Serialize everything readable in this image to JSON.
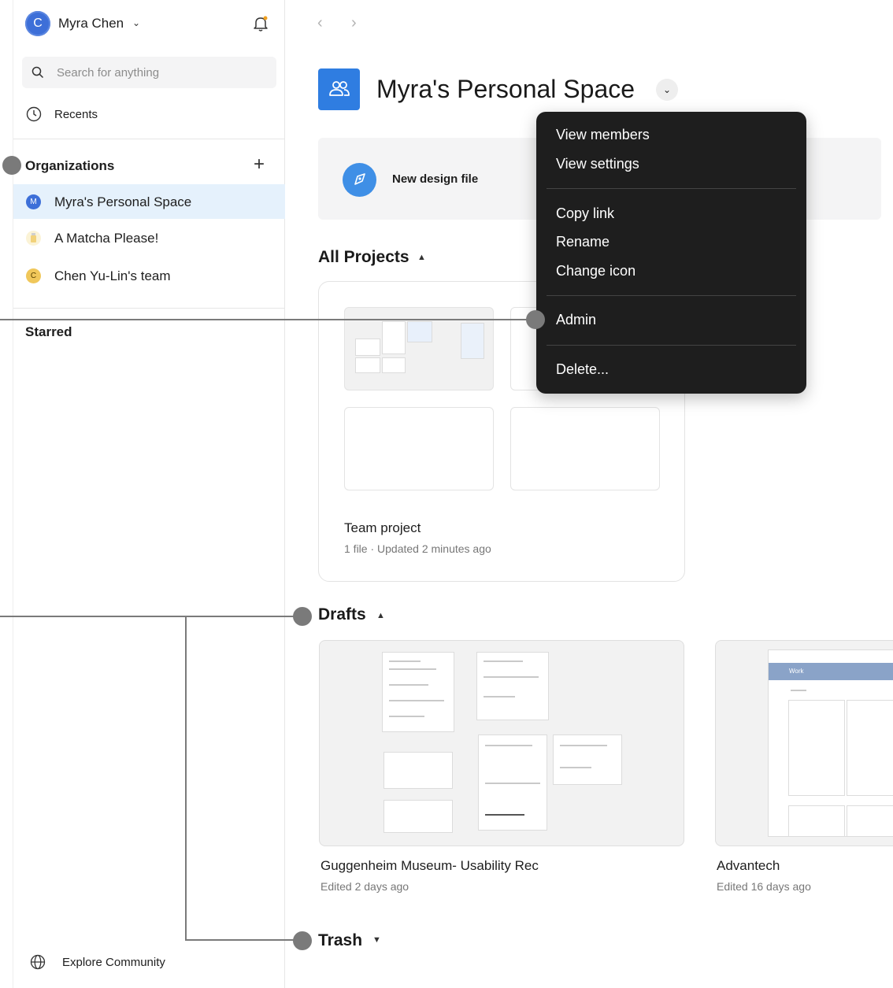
{
  "sidebar": {
    "user": {
      "initial": "C",
      "name": "Myra Chen"
    },
    "search_placeholder": "Search for anything",
    "recents_label": "Recents",
    "organizations_title": "Organizations",
    "organizations": [
      {
        "initial": "M",
        "label": "Myra's Personal Space",
        "color": "#3d6fd8",
        "active": true
      },
      {
        "initial": "",
        "label": "A Matcha Please!",
        "color": "#f5e9b8",
        "active": false
      },
      {
        "initial": "C",
        "label": "Chen Yu-Lin's team",
        "color": "#f0c75a",
        "active": false
      }
    ],
    "starred_title": "Starred",
    "explore_label": "Explore Community"
  },
  "header": {
    "title": "Myra's Personal Space"
  },
  "new_panel": {
    "new_design_label": "New design file"
  },
  "all_projects": {
    "title": "All Projects",
    "project": {
      "name": "Team project",
      "meta": "1 file · Updated 2 minutes ago"
    }
  },
  "drafts": {
    "title": "Drafts",
    "items": [
      {
        "name": "Guggenheim Museum- Usability Rec",
        "meta": "Edited 2 days ago"
      },
      {
        "name": "Advantech",
        "meta": "Edited 16 days ago",
        "thumb_header": "Work"
      }
    ]
  },
  "trash": {
    "title": "Trash"
  },
  "context_menu": {
    "items": [
      "View members",
      "View settings",
      "Copy link",
      "Rename",
      "Change icon",
      "Admin",
      "Delete..."
    ]
  },
  "colors": {
    "accent": "#2f7de1",
    "menu_bg": "#1e1e1e",
    "active_row": "#e5f1fc",
    "annotation": "#7a7a7a"
  }
}
